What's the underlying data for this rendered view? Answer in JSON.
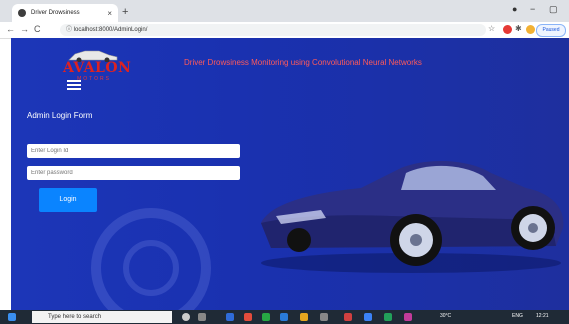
{
  "browser": {
    "tab_title": "Driver Drowsiness",
    "tab_close": "×",
    "new_tab": "+",
    "min": "−",
    "max": "▢",
    "close": "×",
    "url": "localhost:8000/AdminLogin/",
    "paused_label": "Paused"
  },
  "page": {
    "logo_text": "AVALON",
    "logo_sub": "MOTORS",
    "header_title": "Driver Drowsiness Monitoring using Convolutional Neural Networks",
    "form_title": "Admin Login Form",
    "login_placeholder": "Enter Login Id",
    "password_placeholder": "Enter password",
    "login_button": "Login"
  },
  "taskbar": {
    "search_placeholder": "Type here to search",
    "weather": "30°C",
    "lang": "ENG",
    "time": "12:21"
  },
  "colors": {
    "page_bg": "#1c36b8",
    "title_red": "#ff5a5a",
    "button_blue": "#0a84ff"
  }
}
